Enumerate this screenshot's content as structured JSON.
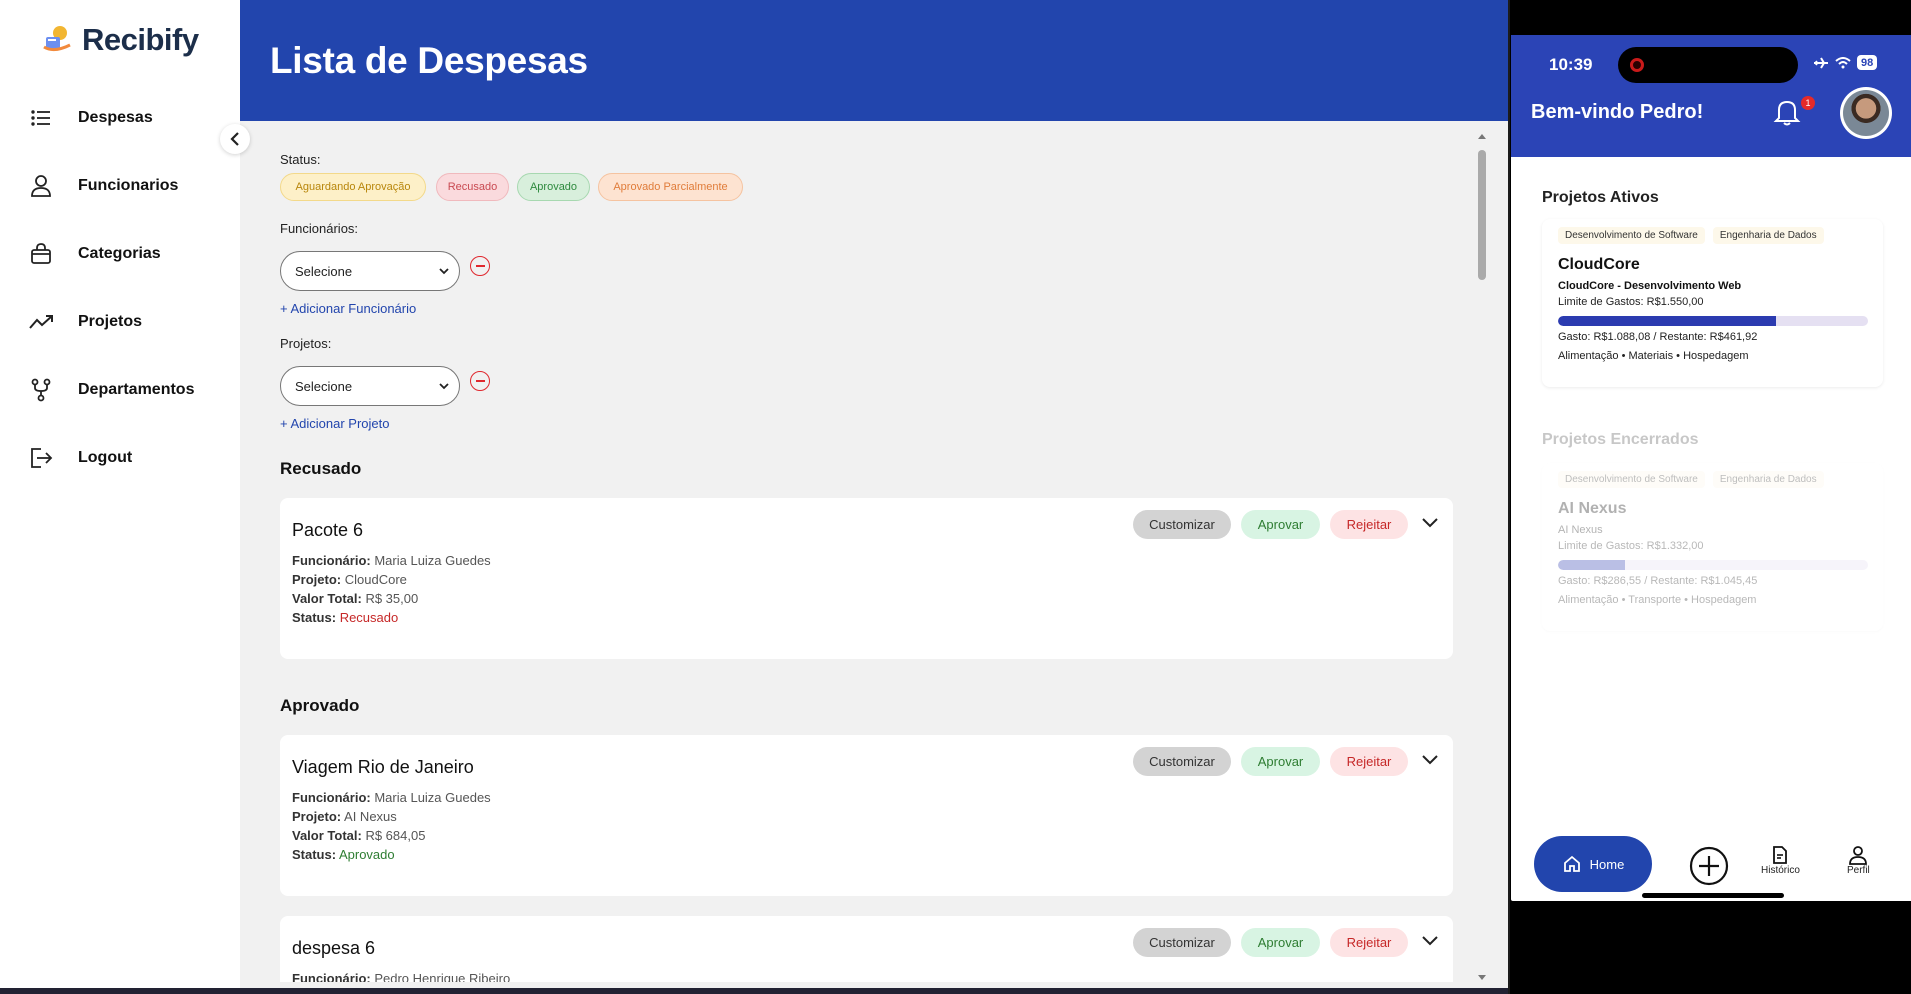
{
  "app": {
    "name": "Recibify"
  },
  "sidebar": {
    "items": [
      {
        "label": "Despesas",
        "icon": "list-icon"
      },
      {
        "label": "Funcionarios",
        "icon": "user-icon"
      },
      {
        "label": "Categorias",
        "icon": "shopping-bag-icon"
      },
      {
        "label": "Projetos",
        "icon": "trend-icon"
      },
      {
        "label": "Departamentos",
        "icon": "branch-icon"
      },
      {
        "label": "Logout",
        "icon": "logout-icon"
      }
    ]
  },
  "header": {
    "title": "Lista de Despesas"
  },
  "filters": {
    "status_label": "Status:",
    "statuses": [
      "Aguardando Aprovação",
      "Recusado",
      "Aprovado",
      "Aprovado Parcialmente"
    ],
    "funcionarios_label": "Funcionários:",
    "funcionario_select": "Selecione",
    "add_funcionario": "+ Adicionar Funcionário",
    "projetos_label": "Projetos:",
    "projeto_select": "Selecione",
    "add_projeto": "+ Adicionar Projeto"
  },
  "sections": [
    {
      "title": "Recusado",
      "cards": [
        {
          "title": "Pacote 6",
          "funcionario": "Maria Luiza Guedes",
          "projeto": "CloudCore",
          "valor": "R$ 35,00",
          "status": "Recusado"
        }
      ]
    },
    {
      "title": "Aprovado",
      "cards": [
        {
          "title": "Viagem Rio de Janeiro",
          "funcionario": "Maria Luiza Guedes",
          "projeto": "AI Nexus",
          "valor": "R$ 684,05",
          "status": "Aprovado"
        },
        {
          "title": "despesa 6",
          "funcionario": "Pedro Henrique Ribeiro"
        }
      ]
    }
  ],
  "card_labels": {
    "funcionario": "Funcionário:",
    "projeto": "Projeto:",
    "valor": "Valor Total:",
    "status": "Status:",
    "customizar": "Customizar",
    "aprovar": "Aprovar",
    "rejeitar": "Rejeitar"
  },
  "phone": {
    "time": "10:39",
    "battery": "98",
    "welcome": "Bem-vindo Pedro!",
    "notifications": "1",
    "active_title": "Projetos Ativos",
    "active": {
      "tags": [
        "Desenvolvimento de Software",
        "Engenharia de Dados"
      ],
      "name": "CloudCore",
      "sub": "CloudCore - Desenvolvimento Web",
      "limit": "Limite de Gastos: R$1.550,00",
      "progress": 0.702,
      "spent": "Gasto: R$1.088,08 / Restante: R$461,92",
      "categories": "Alimentação • Materiais • Hospedagem"
    },
    "closed_title": "Projetos Encerrados",
    "closed": {
      "tags": [
        "Desenvolvimento de Software",
        "Engenharia de Dados"
      ],
      "name": "AI Nexus",
      "sub": "AI Nexus",
      "limit": "Limite de Gastos: R$1.332,00",
      "progress": 0.215,
      "spent": "Gasto: R$286,55 / Restante: R$1.045,45",
      "categories": "Alimentação • Transporte • Hospedagem"
    },
    "nav": {
      "home": "Home",
      "historico": "Histórico",
      "perfil": "Perfil"
    }
  },
  "colors": {
    "brand": "#2245ad",
    "recusado": "#c62828",
    "aprovado": "#2e7d32"
  }
}
